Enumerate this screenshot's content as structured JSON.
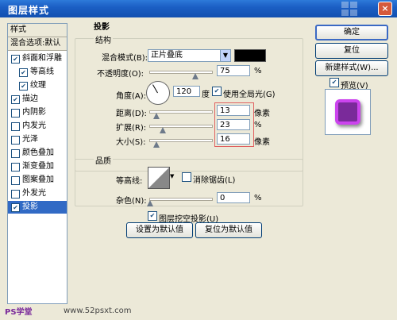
{
  "window": {
    "title": "图层样式",
    "close_glyph": "×"
  },
  "styles_panel": {
    "header": "样式",
    "blend_default": "混合选项:默认",
    "items": [
      {
        "label": "斜面和浮雕",
        "checked": true
      },
      {
        "label": "等高线",
        "checked": true
      },
      {
        "label": "纹理",
        "checked": true
      },
      {
        "label": "描边",
        "checked": true
      },
      {
        "label": "内阴影",
        "checked": false
      },
      {
        "label": "内发光",
        "checked": false
      },
      {
        "label": "光泽",
        "checked": false
      },
      {
        "label": "颜色叠加",
        "checked": false
      },
      {
        "label": "渐变叠加",
        "checked": false
      },
      {
        "label": "图案叠加",
        "checked": false
      },
      {
        "label": "外发光",
        "checked": false
      },
      {
        "label": "投影",
        "checked": true,
        "selected": true
      }
    ]
  },
  "shadow": {
    "section_title": "投影",
    "structure_title": "结构",
    "blend_mode_label": "混合模式(B):",
    "blend_mode_value": "正片叠底",
    "shadow_color": "#000000",
    "opacity_label": "不透明度(O):",
    "opacity_value": "75",
    "opacity_fraction": 0.75,
    "opacity_unit": "%",
    "angle_label": "角度(A):",
    "angle_value": "120",
    "angle_unit": "度",
    "global_light_label": "使用全局光(G)",
    "global_light_checked": true,
    "distance_label": "距离(D):",
    "distance_value": "13",
    "distance_unit": "像素",
    "spread_label": "扩展(R):",
    "spread_value": "23",
    "spread_unit": "%",
    "size_label": "大小(S):",
    "size_value": "16",
    "size_unit": "像素",
    "quality_title": "品质",
    "contour_label": "等高线:",
    "antialias_label": "消除锯齿(L)",
    "antialias_checked": false,
    "noise_label": "杂色(N):",
    "noise_value": "0",
    "noise_unit": "%",
    "knockout_label": "图层挖空投影(U)",
    "knockout_checked": true,
    "set_default_label": "设置为默认值",
    "reset_default_label": "复位为默认值"
  },
  "right_panel": {
    "ok_label": "确定",
    "reset_label": "复位",
    "new_style_label": "新建样式(W)...",
    "preview_label": "预览(V)",
    "preview_checked": true
  },
  "footer": {
    "watermark_left": "PS学堂",
    "watermark_right": "www.52psxt.com"
  },
  "colors": {
    "selection": "#316ac5",
    "title_bar": "#1b5fc4",
    "preview_purple": "#cc44ee"
  }
}
